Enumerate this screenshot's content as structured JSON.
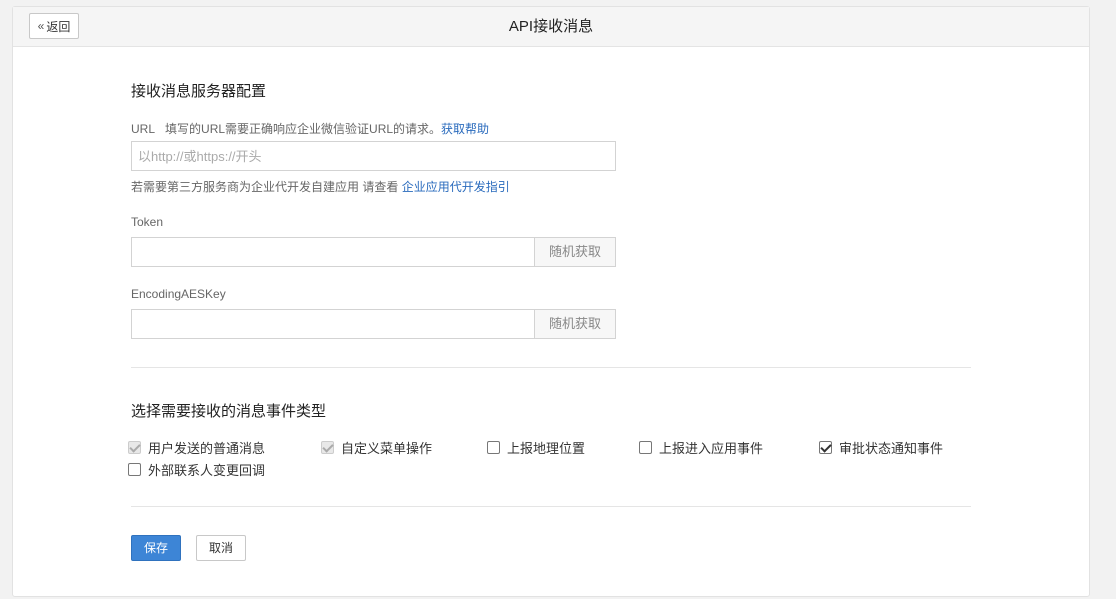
{
  "header": {
    "back_label": "返回",
    "title": "API接收消息"
  },
  "server_config": {
    "title": "接收消息服务器配置",
    "url_label": "URL",
    "url_desc": "填写的URL需要正确响应企业微信验证URL的请求。",
    "url_help_link": "获取帮助",
    "url_placeholder": "以http://或https://开头",
    "url_value": "",
    "hint_text": "若需要第三方服务商为企业代开发自建应用 请查看",
    "hint_link": "企业应用代开发指引",
    "token_label": "Token",
    "token_value": "",
    "token_random_label": "随机获取",
    "aes_label": "EncodingAESKey",
    "aes_value": "",
    "aes_random_label": "随机获取"
  },
  "events": {
    "title": "选择需要接收的消息事件类型",
    "items": [
      {
        "label": "用户发送的普通消息",
        "checked": true,
        "disabled": true
      },
      {
        "label": "自定义菜单操作",
        "checked": true,
        "disabled": true
      },
      {
        "label": "上报地理位置",
        "checked": false,
        "disabled": false
      },
      {
        "label": "上报进入应用事件",
        "checked": false,
        "disabled": false
      },
      {
        "label": "审批状态通知事件",
        "checked": true,
        "disabled": false
      },
      {
        "label": "外部联系人变更回调",
        "checked": false,
        "disabled": false
      }
    ]
  },
  "actions": {
    "save_label": "保存",
    "cancel_label": "取消"
  },
  "colors": {
    "primary": "#3d85d6",
    "link": "#2a6bbd"
  }
}
